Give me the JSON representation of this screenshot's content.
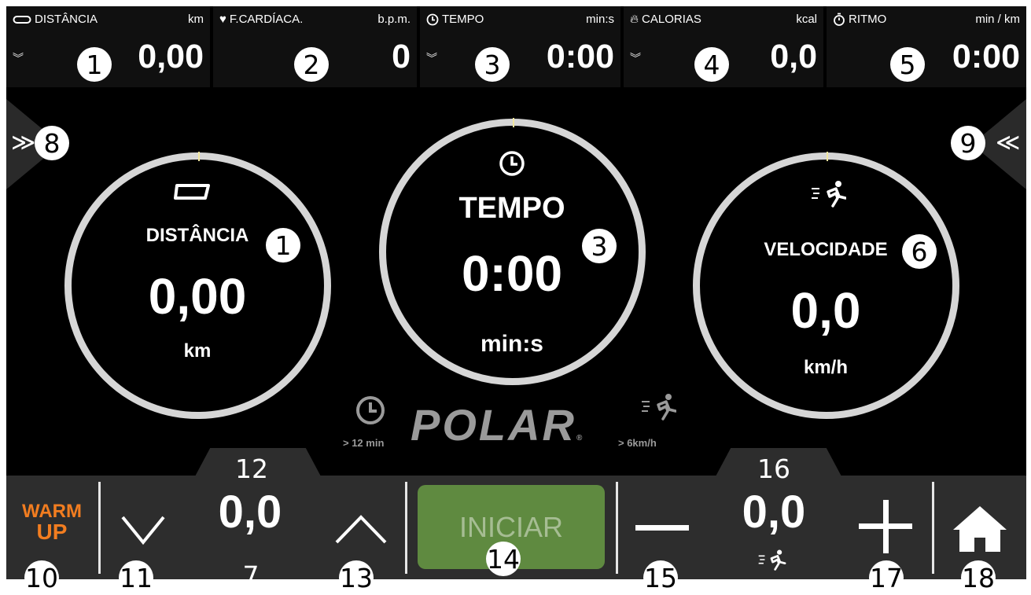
{
  "top_bar": [
    {
      "id": "distancia",
      "icon": "shoe-icon",
      "label": "DISTÂNCIA",
      "unit": "km",
      "value": "0,00",
      "has_chevron": true,
      "callout": "1"
    },
    {
      "id": "fcardiaca",
      "icon": "heart-icon",
      "label": "F.CARDÍACA.",
      "unit": "b.p.m.",
      "value": "0",
      "has_chevron": false,
      "callout": "2"
    },
    {
      "id": "tempo",
      "icon": "clock-icon",
      "label": "TEMPO",
      "unit": "min:s",
      "value": "0:00",
      "has_chevron": true,
      "callout": "3"
    },
    {
      "id": "calorias",
      "icon": "flame-icon",
      "label": "CALORIAS",
      "unit": "kcal",
      "value": "0,0",
      "has_chevron": true,
      "callout": "4"
    },
    {
      "id": "ritmo",
      "icon": "stopwatch-icon",
      "label": "RITMO",
      "unit": "min / km",
      "value": "0:00",
      "has_chevron": false,
      "callout": "5"
    }
  ],
  "chevron_glyph": "»",
  "dials": {
    "distancia": {
      "title": "DISTÂNCIA",
      "value": "0,00",
      "unit": "km",
      "callout": "1"
    },
    "tempo": {
      "title": "TEMPO",
      "value": "0:00",
      "unit": "min:s",
      "callout": "3"
    },
    "velocidade": {
      "title": "VELOCIDADE",
      "value": "0,0",
      "unit": "km/h",
      "callout": "6"
    }
  },
  "side_tabs": {
    "left": {
      "glyph": "≫",
      "callout": "8"
    },
    "right": {
      "glyph": "≪",
      "callout": "9"
    }
  },
  "polar": {
    "logo_text": "POLAR",
    "registered": "®",
    "time_hint": "> 12 min",
    "speed_hint": "> 6km/h"
  },
  "bottom": {
    "warmup_line1": "WARM",
    "warmup_line2": "UP",
    "incline_value": "0,0",
    "start_label": "INICIAR",
    "speed_value": "0,0",
    "callouts": {
      "warmup": "10",
      "down": "11",
      "incline_label": "7",
      "incline_top": "12",
      "up": "13",
      "start": "14",
      "minus": "15",
      "speed_top": "16",
      "plus": "17",
      "home": "18"
    }
  },
  "colors": {
    "accent_orange": "#f27d20",
    "start_green": "#5f8a40",
    "start_text": "#a6bd93",
    "ring": "#d6d6d6"
  }
}
